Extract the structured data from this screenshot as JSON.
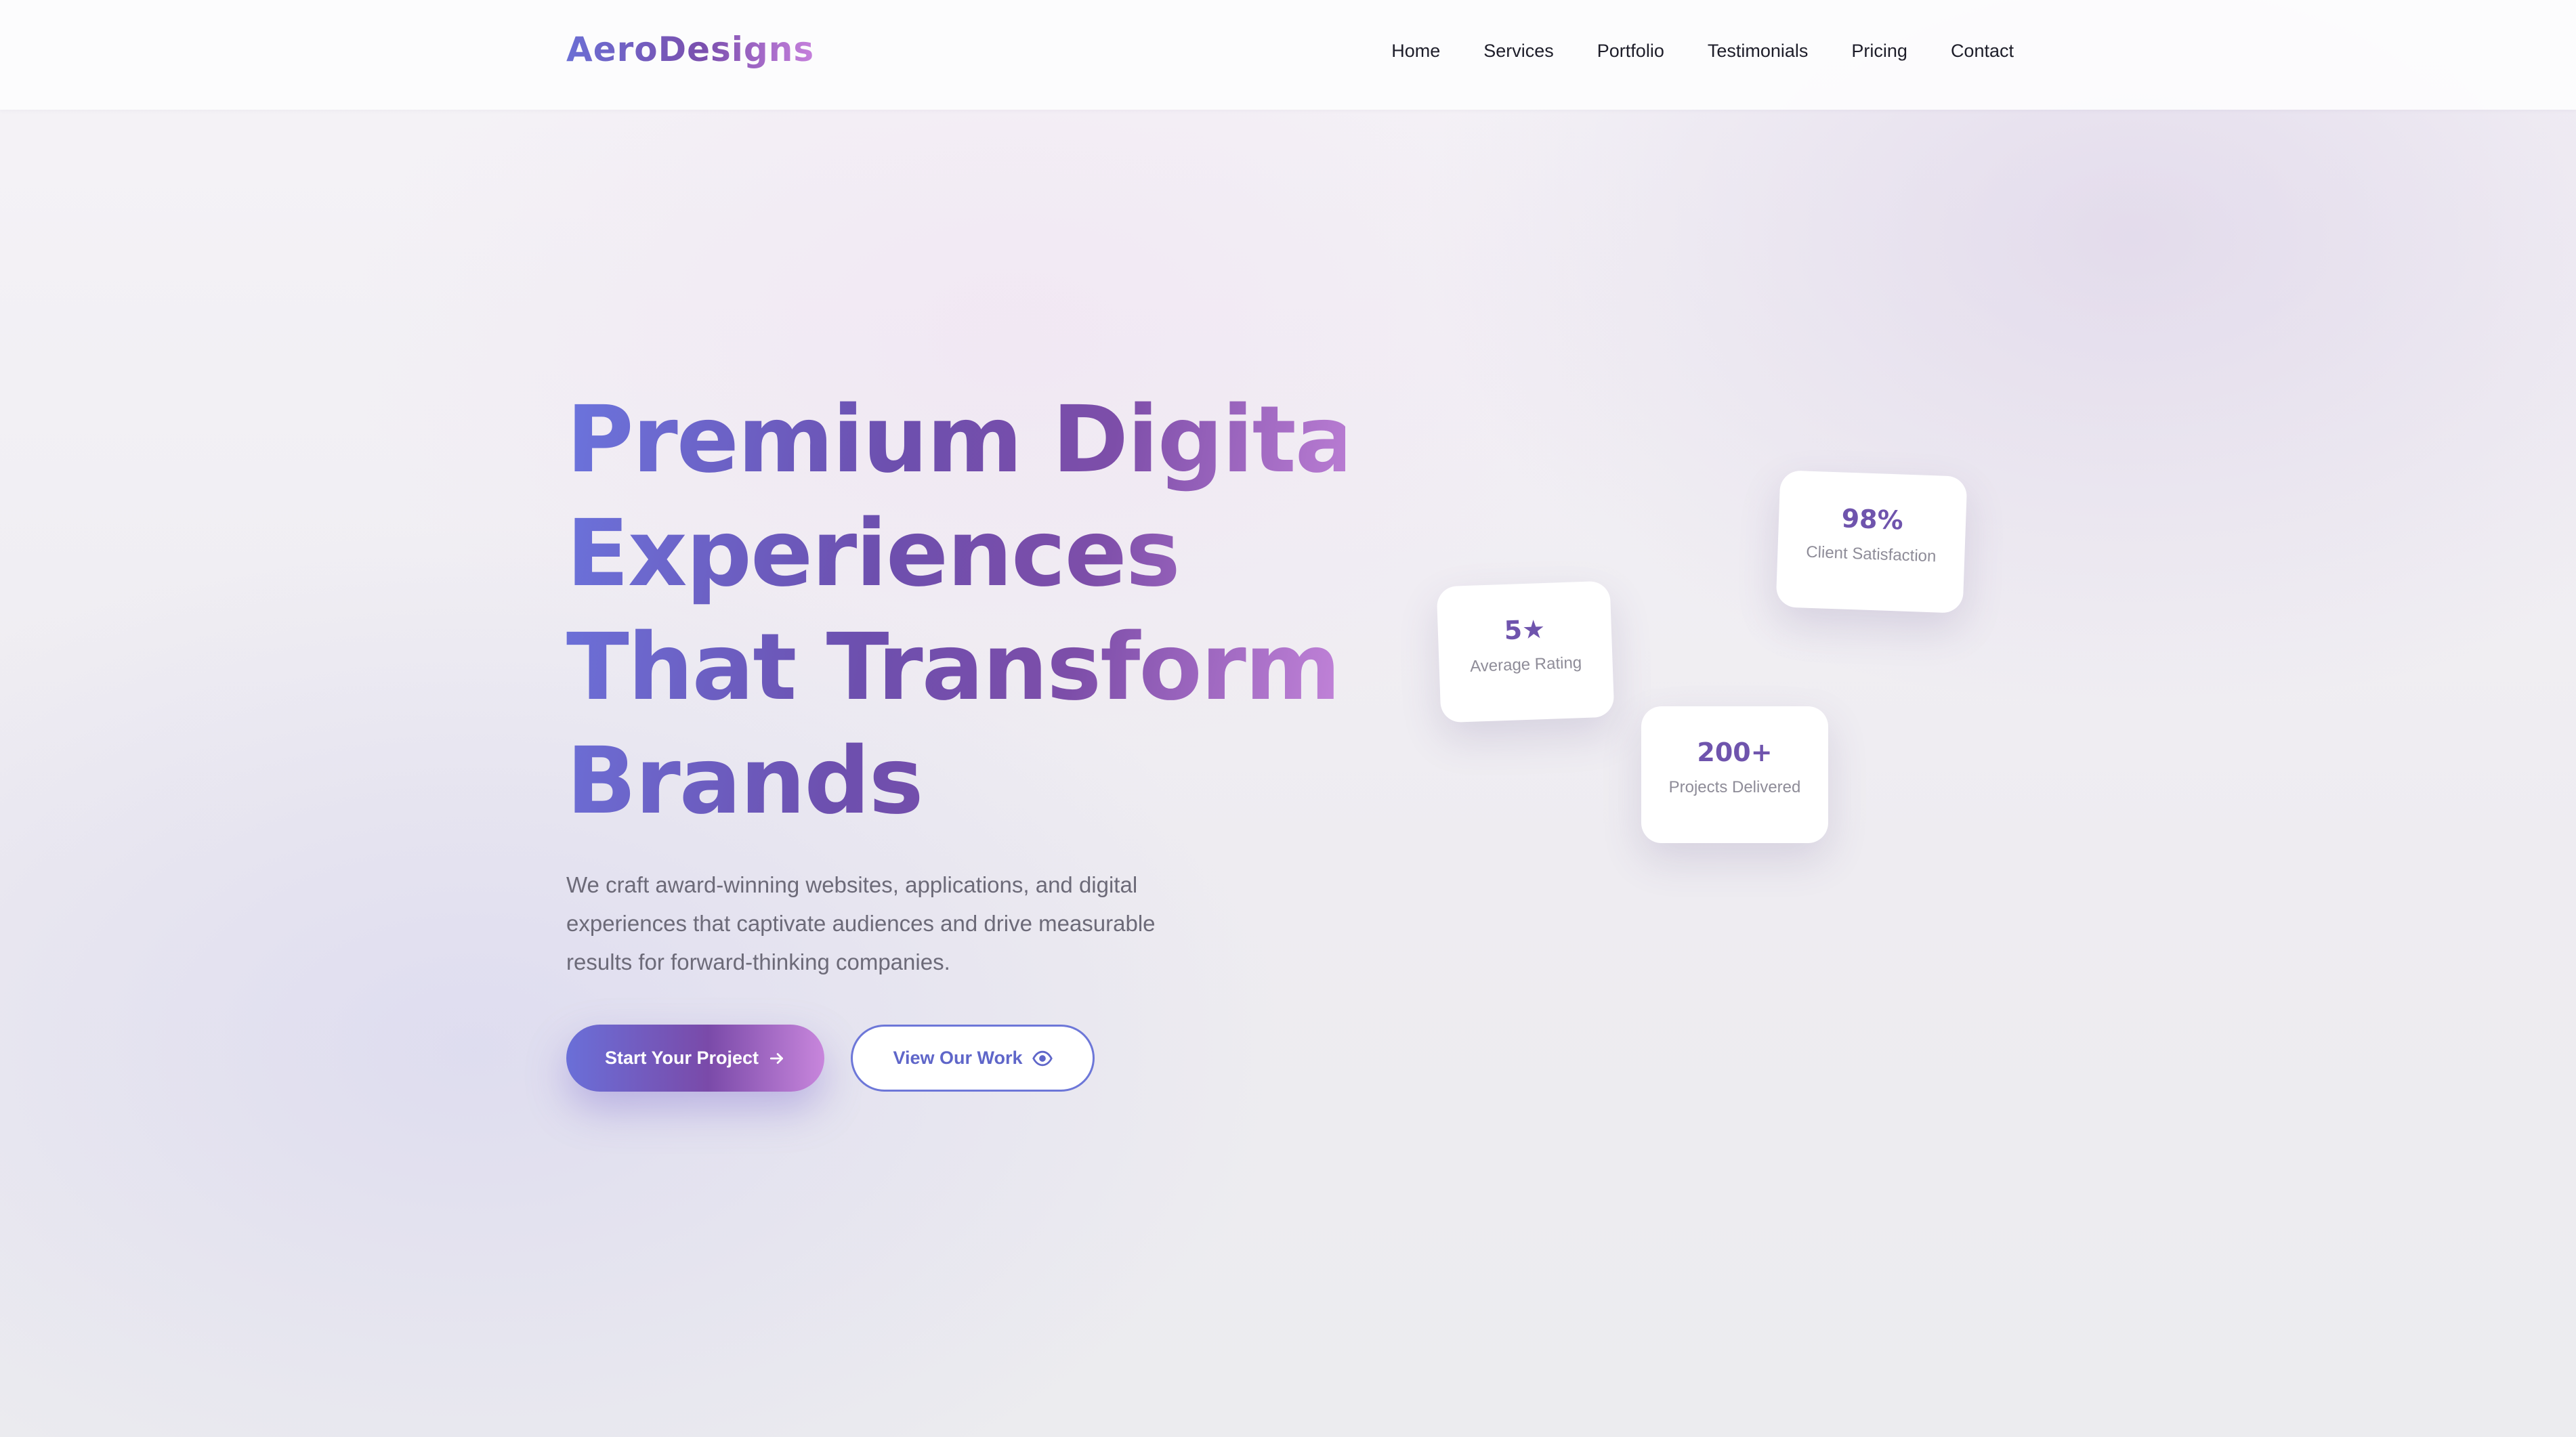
{
  "brand": {
    "logo_text": "AeroDesigns"
  },
  "nav": {
    "items": [
      {
        "label": "Home"
      },
      {
        "label": "Services"
      },
      {
        "label": "Portfolio"
      },
      {
        "label": "Testimonials"
      },
      {
        "label": "Pricing"
      },
      {
        "label": "Contact"
      }
    ]
  },
  "hero": {
    "title_lines": [
      "Premium Digital",
      "Experiences",
      "That Transform",
      "Brands"
    ],
    "subtitle": "We craft award-winning websites, applications, and digital experiences that captivate audiences and drive measurable results for forward-thinking companies.",
    "primary_button": {
      "label": "Start Your Project",
      "icon": "arrow-right-icon"
    },
    "secondary_button": {
      "label": "View Our Work",
      "icon": "eye-icon"
    }
  },
  "stats": [
    {
      "value": "5★",
      "label": "Average Rating"
    },
    {
      "value": "98%",
      "label": "Client Satisfaction"
    },
    {
      "value": "200+",
      "label": "Projects Delivered"
    }
  ],
  "colors": {
    "gradient_start": "#6b74dd",
    "gradient_mid": "#7a4aa9",
    "gradient_end": "#c886dc",
    "text_body": "#6c6a78",
    "nav_text": "#1e1e2a"
  }
}
